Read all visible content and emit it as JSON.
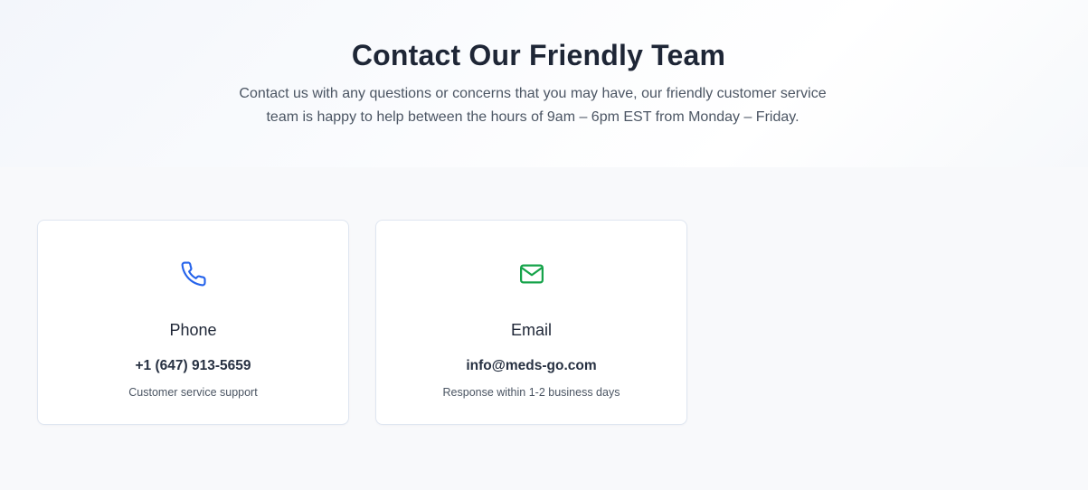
{
  "hero": {
    "title": "Contact Our Friendly Team",
    "subtitle": "Contact us with any questions or concerns that you may have, our friendly customer service team is happy to help between the hours of 9am – 6pm EST from Monday – Friday."
  },
  "contact_cards": [
    {
      "icon": "phone-icon",
      "icon_color": "#2563eb",
      "title": "Phone",
      "value": "+1 (647) 913-5659",
      "note": "Customer service support"
    },
    {
      "icon": "mail-icon",
      "icon_color": "#16a34a",
      "title": "Email",
      "value": "info@meds-go.com",
      "note": "Response within 1-2 business days"
    }
  ],
  "colors": {
    "page_background": "#f8f9fb",
    "card_background": "#ffffff",
    "heading": "#1e2636",
    "body_text": "#4b5563"
  }
}
